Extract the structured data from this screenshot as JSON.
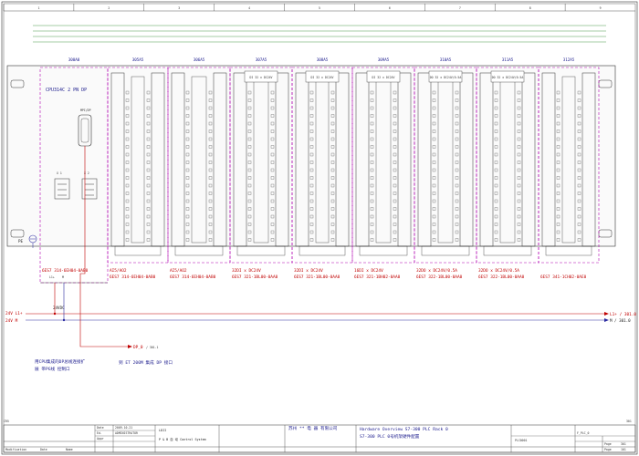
{
  "grid": {
    "columns": [
      "1",
      "2",
      "3",
      "4",
      "5",
      "6",
      "7",
      "8",
      "9"
    ],
    "left_label": "CR5",
    "right_label": "301"
  },
  "rack": {
    "slots": [
      "300A0",
      "305A5",
      "306A5",
      "307A5",
      "308A5",
      "309A5",
      "310A5",
      "311A5",
      "312A5"
    ]
  },
  "cpu": {
    "title": "CPU314C 2 PN DP",
    "port_label": "MPI/DP",
    "x1": "X 1",
    "x2": "X 2",
    "pe": "PE"
  },
  "module_labels": [
    {
      "id": "307A5",
      "lines": [
        "DI 32 x DC24V"
      ]
    },
    {
      "id": "308A5",
      "lines": [
        "DI 32 x DC24V"
      ]
    },
    {
      "id": "309A5",
      "lines": [
        "DI 32 x DC24V"
      ]
    },
    {
      "id": "310A5",
      "lines": [
        "DO 32 x DC24V/0.5A"
      ]
    },
    {
      "id": "311A5",
      "lines": [
        "DO 32 x DC24V/0.5A"
      ]
    }
  ],
  "order_numbers": [
    {
      "line1": "6ES7 314-6EH04-0AB0",
      "line2": ""
    },
    {
      "line1": "AI5/AO2",
      "line2": "6ES7 314-6EH04-0AB0"
    },
    {
      "line1": "AI5/AO2",
      "line2": "6ES7 314-6EH04-0AB0"
    },
    {
      "line1": "32DI x DC24V",
      "line2": "6ES7 321-1BL00-0AA0"
    },
    {
      "line1": "32DI x DC24V",
      "line2": "6ES7 321-1BL00-0AA0"
    },
    {
      "line1": "16DI x DC24V",
      "line2": "6ES7 321-1BH02-0AA0"
    },
    {
      "line1": "32DO x DC24V/0.5A",
      "line2": "6ES7 322-1BL00-0AA0"
    },
    {
      "line1": "32DO x DC24V/0.5A",
      "line2": "6ES7 322-1BL00-0AA0"
    },
    {
      "line1": "",
      "line2": "6ES7 341-1CH02-0AE0"
    }
  ],
  "power": {
    "source_label": "24VDC",
    "l1_in": "24V L1+",
    "m_in": "24V M",
    "l1": "L1+",
    "m": "M",
    "l1_out": "L1+ / 301.0",
    "m_out": "M / 301.0"
  },
  "dp": {
    "label": "DP_0",
    "ref": "/ 301.1"
  },
  "notes": [
    "用CPU集成的DP总线连接扩",
    "展 带PG线 控制口"
  ],
  "note2": "到 ET 200M 集成 DP 接口",
  "title_block": {
    "rev_cells": [
      "Date",
      "Ed.",
      "Appr",
      "Modification",
      "Date",
      "Name"
    ],
    "rev_values": [
      "2009-10-21",
      "ADMINISTRATOR",
      ""
    ],
    "project": "LDII",
    "system": "P & B 自 动 Control System",
    "company_cn": "苏州 ** 电 器 有限公司",
    "description_1": "Hardware Overview S7-300 PLC Rack 0",
    "description_2": "S7-300 PLC 0号机架硬件配置",
    "page_label": "Page",
    "page_value": "301",
    "total_label": "Page",
    "total_value": "101",
    "plc_id": "PLC0001",
    "ref_label": "F_PLC_0"
  }
}
